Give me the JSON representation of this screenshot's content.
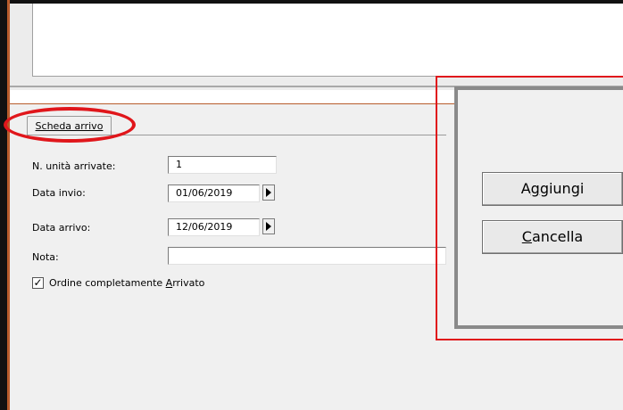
{
  "tab": {
    "label": "Scheda arrivo"
  },
  "form": {
    "units_label": "N. unità arrivate:",
    "units_value": "1",
    "send_date_label": "Data invio:",
    "send_date_value": "01/06/2019",
    "arrival_date_label": "Data arrivo:",
    "arrival_date_value": "12/06/2019",
    "note_label": "Nota:",
    "note_value": "",
    "checkbox_label_pre": "Ordine completamente ",
    "checkbox_label_ul": "A",
    "checkbox_label_post": "rrivato",
    "checkbox_checked": true
  },
  "buttons": {
    "add_pre": "A",
    "add_ul": "g",
    "add_post": "giungi",
    "cancel_ul": "C",
    "cancel_post": "ancella"
  },
  "colors": {
    "highlight": "#e0161b",
    "accent_line": "#b85c2c"
  },
  "icons": {
    "date_picker": "right-triangle",
    "check": "checkmark"
  }
}
